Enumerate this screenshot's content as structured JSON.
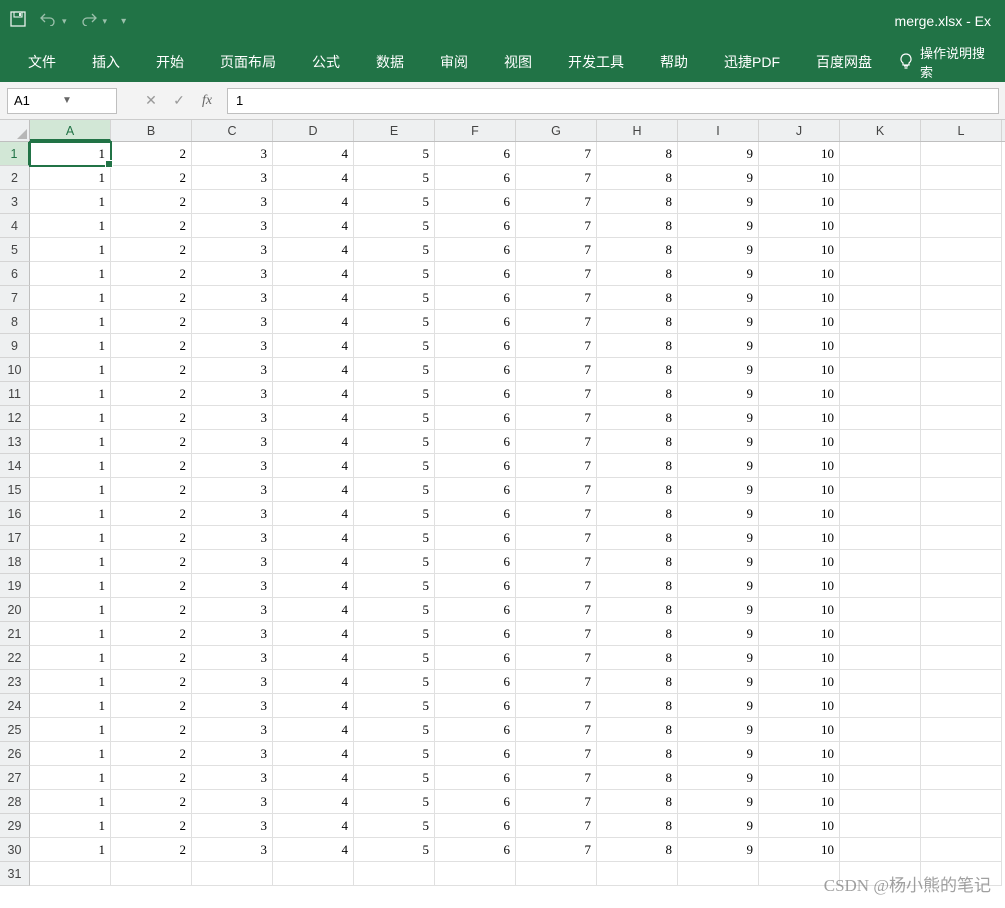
{
  "titlebar": {
    "filename": "merge.xlsx  -  Ex"
  },
  "ribbon": {
    "tabs": [
      "文件",
      "插入",
      "开始",
      "页面布局",
      "公式",
      "数据",
      "审阅",
      "视图",
      "开发工具",
      "帮助",
      "迅捷PDF",
      "百度网盘"
    ],
    "tellme": "操作说明搜索"
  },
  "formula_bar": {
    "name_box": "A1",
    "formula": "1"
  },
  "grid": {
    "columns": [
      "A",
      "B",
      "C",
      "D",
      "E",
      "F",
      "G",
      "H",
      "I",
      "J",
      "K",
      "L"
    ],
    "active_col": "A",
    "active_row": 1,
    "row_count": 31,
    "data_rows": 30,
    "values_per_row": [
      1,
      2,
      3,
      4,
      5,
      6,
      7,
      8,
      9,
      10
    ]
  },
  "watermark": "CSDN @杨小熊的笔记"
}
